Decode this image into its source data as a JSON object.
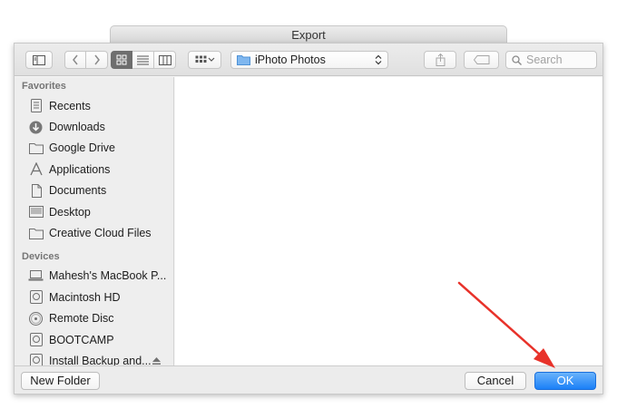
{
  "window": {
    "title": "Export"
  },
  "toolbar": {
    "sidebar_toggle_icon": "sidebar-icon",
    "nav_back_icon": "chevron-left-icon",
    "nav_forward_icon": "chevron-right-icon",
    "view_modes": [
      "icon-view",
      "list-view",
      "column-view"
    ],
    "active_view": "icon-view",
    "arrange_icon": "grid-arrange-icon",
    "location": "iPhoto Photos",
    "share_icon": "share-icon",
    "tag_icon": "tag-icon",
    "search_placeholder": "Search"
  },
  "sidebar": {
    "favorites_header": "Favorites",
    "favorites": [
      {
        "label": "Recents",
        "icon": "clock-icon"
      },
      {
        "label": "Downloads",
        "icon": "download-icon"
      },
      {
        "label": "Google Drive",
        "icon": "folder-icon"
      },
      {
        "label": "Applications",
        "icon": "applications-icon"
      },
      {
        "label": "Documents",
        "icon": "document-icon"
      },
      {
        "label": "Desktop",
        "icon": "desktop-icon"
      },
      {
        "label": "Creative Cloud Files",
        "icon": "folder-icon"
      }
    ],
    "devices_header": "Devices",
    "devices": [
      {
        "label": "Mahesh's MacBook P...",
        "icon": "laptop-icon"
      },
      {
        "label": "Macintosh HD",
        "icon": "disk-icon"
      },
      {
        "label": "Remote Disc",
        "icon": "disc-icon"
      },
      {
        "label": "BOOTCAMP",
        "icon": "disk-icon"
      },
      {
        "label": "Install Backup and...",
        "icon": "disk-icon"
      }
    ]
  },
  "bottom": {
    "new_folder": "New Folder",
    "cancel": "Cancel",
    "ok": "OK"
  },
  "colors": {
    "accent": "#1b80f7",
    "annotation_arrow": "#e8322a"
  }
}
